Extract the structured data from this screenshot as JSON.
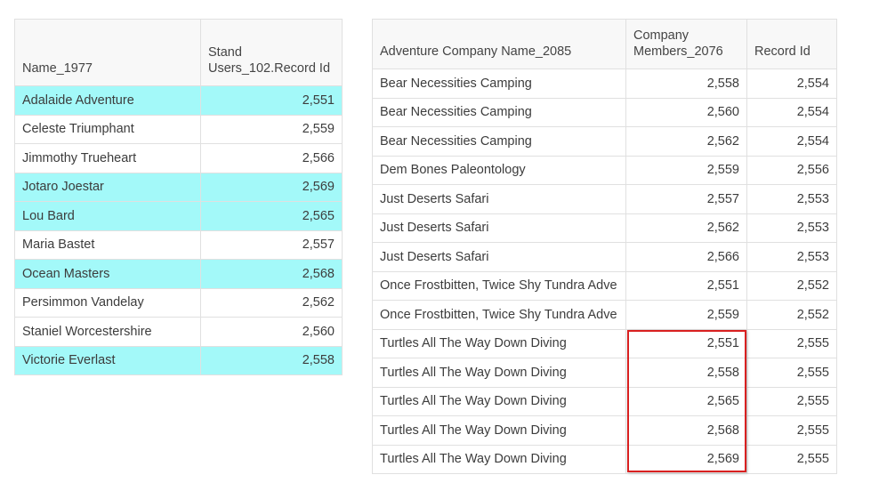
{
  "left_table": {
    "headers": [
      "Name_1977",
      "Stand Users_102.Record Id"
    ],
    "rows": [
      {
        "name": "Adalaide Adventure",
        "value": "2,551",
        "highlighted": true
      },
      {
        "name": "Celeste Triumphant",
        "value": "2,559",
        "highlighted": false
      },
      {
        "name": "Jimmothy Trueheart",
        "value": "2,566",
        "highlighted": false
      },
      {
        "name": "Jotaro Joestar",
        "value": "2,569",
        "highlighted": true
      },
      {
        "name": "Lou Bard",
        "value": "2,565",
        "highlighted": true
      },
      {
        "name": "Maria Bastet",
        "value": "2,557",
        "highlighted": false
      },
      {
        "name": "Ocean Masters",
        "value": "2,568",
        "highlighted": true
      },
      {
        "name": "Persimmon Vandelay",
        "value": "2,562",
        "highlighted": false
      },
      {
        "name": "Staniel Worcestershire",
        "value": "2,560",
        "highlighted": false
      },
      {
        "name": "Victorie Everlast",
        "value": "2,558",
        "highlighted": true
      }
    ]
  },
  "right_table": {
    "headers": [
      "Adventure Company Name_2085",
      "Company Members_2076",
      "Record Id"
    ],
    "rows": [
      {
        "company": "Bear Necessities Camping",
        "members": "2,558",
        "record_id": "2,554"
      },
      {
        "company": "Bear Necessities Camping",
        "members": "2,560",
        "record_id": "2,554"
      },
      {
        "company": "Bear Necessities Camping",
        "members": "2,562",
        "record_id": "2,554"
      },
      {
        "company": "Dem Bones Paleontology",
        "members": "2,559",
        "record_id": "2,556"
      },
      {
        "company": "Just Deserts Safari",
        "members": "2,557",
        "record_id": "2,553"
      },
      {
        "company": "Just Deserts Safari",
        "members": "2,562",
        "record_id": "2,553"
      },
      {
        "company": "Just Deserts Safari",
        "members": "2,566",
        "record_id": "2,553"
      },
      {
        "company": "Once Frostbitten, Twice Shy Tundra Adve",
        "members": "2,551",
        "record_id": "2,552"
      },
      {
        "company": "Once Frostbitten, Twice Shy Tundra Adve",
        "members": "2,559",
        "record_id": "2,552"
      },
      {
        "company": "Turtles All The Way Down Diving",
        "members": "2,551",
        "record_id": "2,555"
      },
      {
        "company": "Turtles All The Way Down Diving",
        "members": "2,558",
        "record_id": "2,555"
      },
      {
        "company": "Turtles All The Way Down Diving",
        "members": "2,565",
        "record_id": "2,555"
      },
      {
        "company": "Turtles All The Way Down Diving",
        "members": "2,568",
        "record_id": "2,555"
      },
      {
        "company": "Turtles All The Way Down Diving",
        "members": "2,569",
        "record_id": "2,555"
      }
    ]
  },
  "colors": {
    "highlight": "#a3f9f9",
    "selection_border": "#d92020"
  }
}
